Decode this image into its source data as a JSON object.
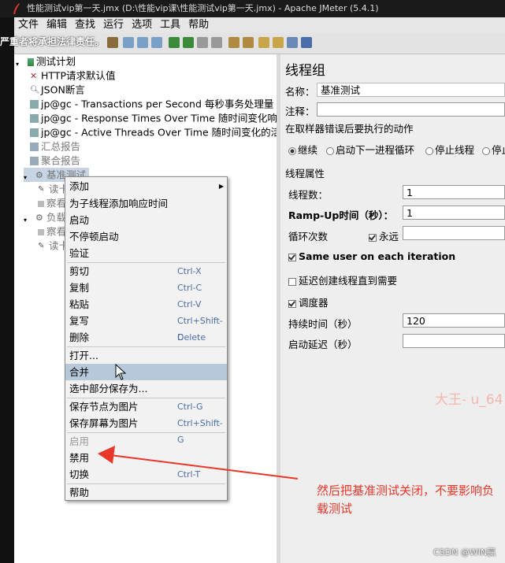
{
  "window": {
    "title": "性能测试vip第一天.jmx (D:\\性能vip课\\性能测试vip第一天.jmx) - Apache JMeter (5.4.1)",
    "warning_overlay": "严重者将承担法律责任。"
  },
  "menu": [
    "文件",
    "编辑",
    "查找",
    "运行",
    "选项",
    "工具",
    "帮助"
  ],
  "tree": {
    "items": [
      {
        "label": "测试计划",
        "icon": "test-plan-icon"
      },
      {
        "label": "HTTP请求默认值",
        "icon": "wrench-icon"
      },
      {
        "label": "JSON断言",
        "icon": "magnifier-icon"
      },
      {
        "label": "jp@gc - Transactions per Second 每秒事务处理量",
        "icon": "graph-icon"
      },
      {
        "label": "jp@gc - Response Times Over Time 随时间变化响",
        "icon": "graph-icon"
      },
      {
        "label": "jp@gc - Active Threads Over Time 随时间变化的活",
        "icon": "graph-icon"
      },
      {
        "label": "汇总报告",
        "icon": "report-icon"
      },
      {
        "label": "聚合报告",
        "icon": "report-icon"
      },
      {
        "label": "基准测试",
        "icon": "gear-icon"
      },
      {
        "label": "读卡",
        "icon": "pencil-icon"
      },
      {
        "label": "察看",
        "icon": "listener-icon"
      },
      {
        "label": "负载测",
        "icon": "gear-icon"
      },
      {
        "label": "察看",
        "icon": "listener-icon"
      },
      {
        "label": "读卡",
        "icon": "pencil-icon"
      }
    ]
  },
  "context_menu": {
    "items": [
      {
        "label": "添加",
        "submenu": true
      },
      {
        "label": "为子线程添加响应时间"
      },
      {
        "label": "启动"
      },
      {
        "label": "不停顿启动"
      },
      {
        "label": "验证"
      },
      {
        "label": "剪切",
        "shortcut": "Ctrl-X"
      },
      {
        "label": "复制",
        "shortcut": "Ctrl-C"
      },
      {
        "label": "粘贴",
        "shortcut": "Ctrl-V"
      },
      {
        "label": "复写",
        "shortcut": "Ctrl+Shift-C"
      },
      {
        "label": "删除",
        "shortcut": "Delete"
      },
      {
        "label": "打开..."
      },
      {
        "label": "合并"
      },
      {
        "label": "选中部分保存为..."
      },
      {
        "label": "保存节点为图片",
        "shortcut": "Ctrl-G"
      },
      {
        "label": "保存屏幕为图片",
        "shortcut": "Ctrl+Shift-G"
      },
      {
        "label": "启用"
      },
      {
        "label": "禁用"
      },
      {
        "label": "切换",
        "shortcut": "Ctrl-T"
      },
      {
        "label": "帮助"
      }
    ]
  },
  "thread_group": {
    "title": "线程组",
    "name_label": "名称：",
    "name_value": "基准测试",
    "comment_label": "注释：",
    "comment_value": "",
    "error_section": "在取样器错误后要执行的动作",
    "error_options": [
      "继续",
      "启动下一进程循环",
      "停止线程",
      "停止"
    ],
    "props_section": "线程属性",
    "threads_label": "线程数：",
    "threads_value": "1",
    "rampup_label": "Ramp-Up时间（秒）：",
    "rampup_value": "1",
    "loop_label": "循环次数",
    "loop_forever": "永远",
    "same_user": "Same user on each iteration",
    "delay_create": "延迟创建线程直到需要",
    "scheduler": "调度器",
    "duration_label": "持续时间（秒）",
    "duration_value": "120",
    "startup_delay_label": "启动延迟（秒）",
    "startup_delay_value": ""
  },
  "watermark": "大王- u_64",
  "annotation": "然后把基准测试关闭，不要影响负载测试",
  "csdn": "CSDN @WIN赢",
  "colors": {
    "annotation": "#e8372a",
    "highlight": "#b7c8da"
  }
}
